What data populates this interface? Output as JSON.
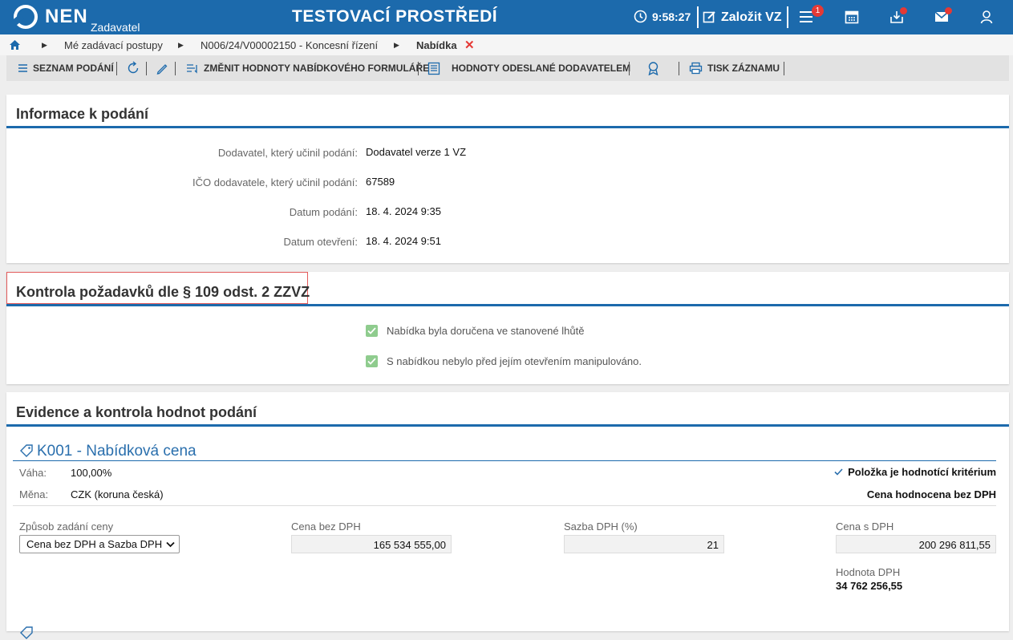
{
  "header": {
    "logo": "NEN",
    "logo_sub": "Zadavatel",
    "env_title": "TESTOVACÍ PROSTŘEDÍ",
    "clock": "9:58:27",
    "create_label": "Založit VZ",
    "menu_badge": "1",
    "accent": "#1c6aac"
  },
  "breadcrumb": {
    "items": [
      "Mé zadávací postupy",
      "N006/24/V00002150 - Koncesní řízení",
      "Nabídka"
    ]
  },
  "toolbar": {
    "list_label": "SEZNAM PODÁNÍ",
    "change_label": "ZMĚNIT HODNOTY NABÍDKOVÉHO FORMULÁŘE",
    "sent_values_label": "HODNOTY ODESLANÉ DODAVATELEM",
    "print_label": "TISK ZÁZNAMU"
  },
  "info": {
    "title": "Informace k podání",
    "rows": [
      {
        "label": "Dodavatel, který učinil podání:",
        "value": "Dodavatel verze 1 VZ"
      },
      {
        "label": "IČO dodavatele, který učinil podání:",
        "value": "67589"
      },
      {
        "label": "Datum podání:",
        "value": "18. 4. 2024 9:35"
      },
      {
        "label": "Datum otevření:",
        "value": "18. 4. 2024 9:51"
      }
    ]
  },
  "control": {
    "title": "Kontrola požadavků dle § 109 odst. 2 ZZVZ",
    "checks": [
      "Nabídka byla doručena ve stanovené lhůtě",
      "S nabídkou nebylo před jejím otevřením manipulováno."
    ]
  },
  "evidence": {
    "title": "Evidence a kontrola hodnot podání",
    "item_title": "K001 - Nabídková cena",
    "weight_label": "Váha:",
    "weight_value": "100,00%",
    "currency_label": "Měna:",
    "currency_value": "CZK (koruna česká)",
    "criterion_label": "Položka je hodnotící kritérium",
    "evaluated_label": "Cena hodnocena bez DPH",
    "method_label": "Způsob zadání ceny",
    "method_value": "Cena bez DPH a Sazba DPH",
    "price_label": "Cena bez DPH",
    "price_value": "165 534 555,00",
    "vat_rate_label": "Sazba DPH (%)",
    "vat_rate_value": "21",
    "price_vat_label": "Cena s DPH",
    "price_vat_value": "200 296 811,55",
    "vat_value_label": "Hodnota DPH",
    "vat_value": "34 762 256,55"
  }
}
